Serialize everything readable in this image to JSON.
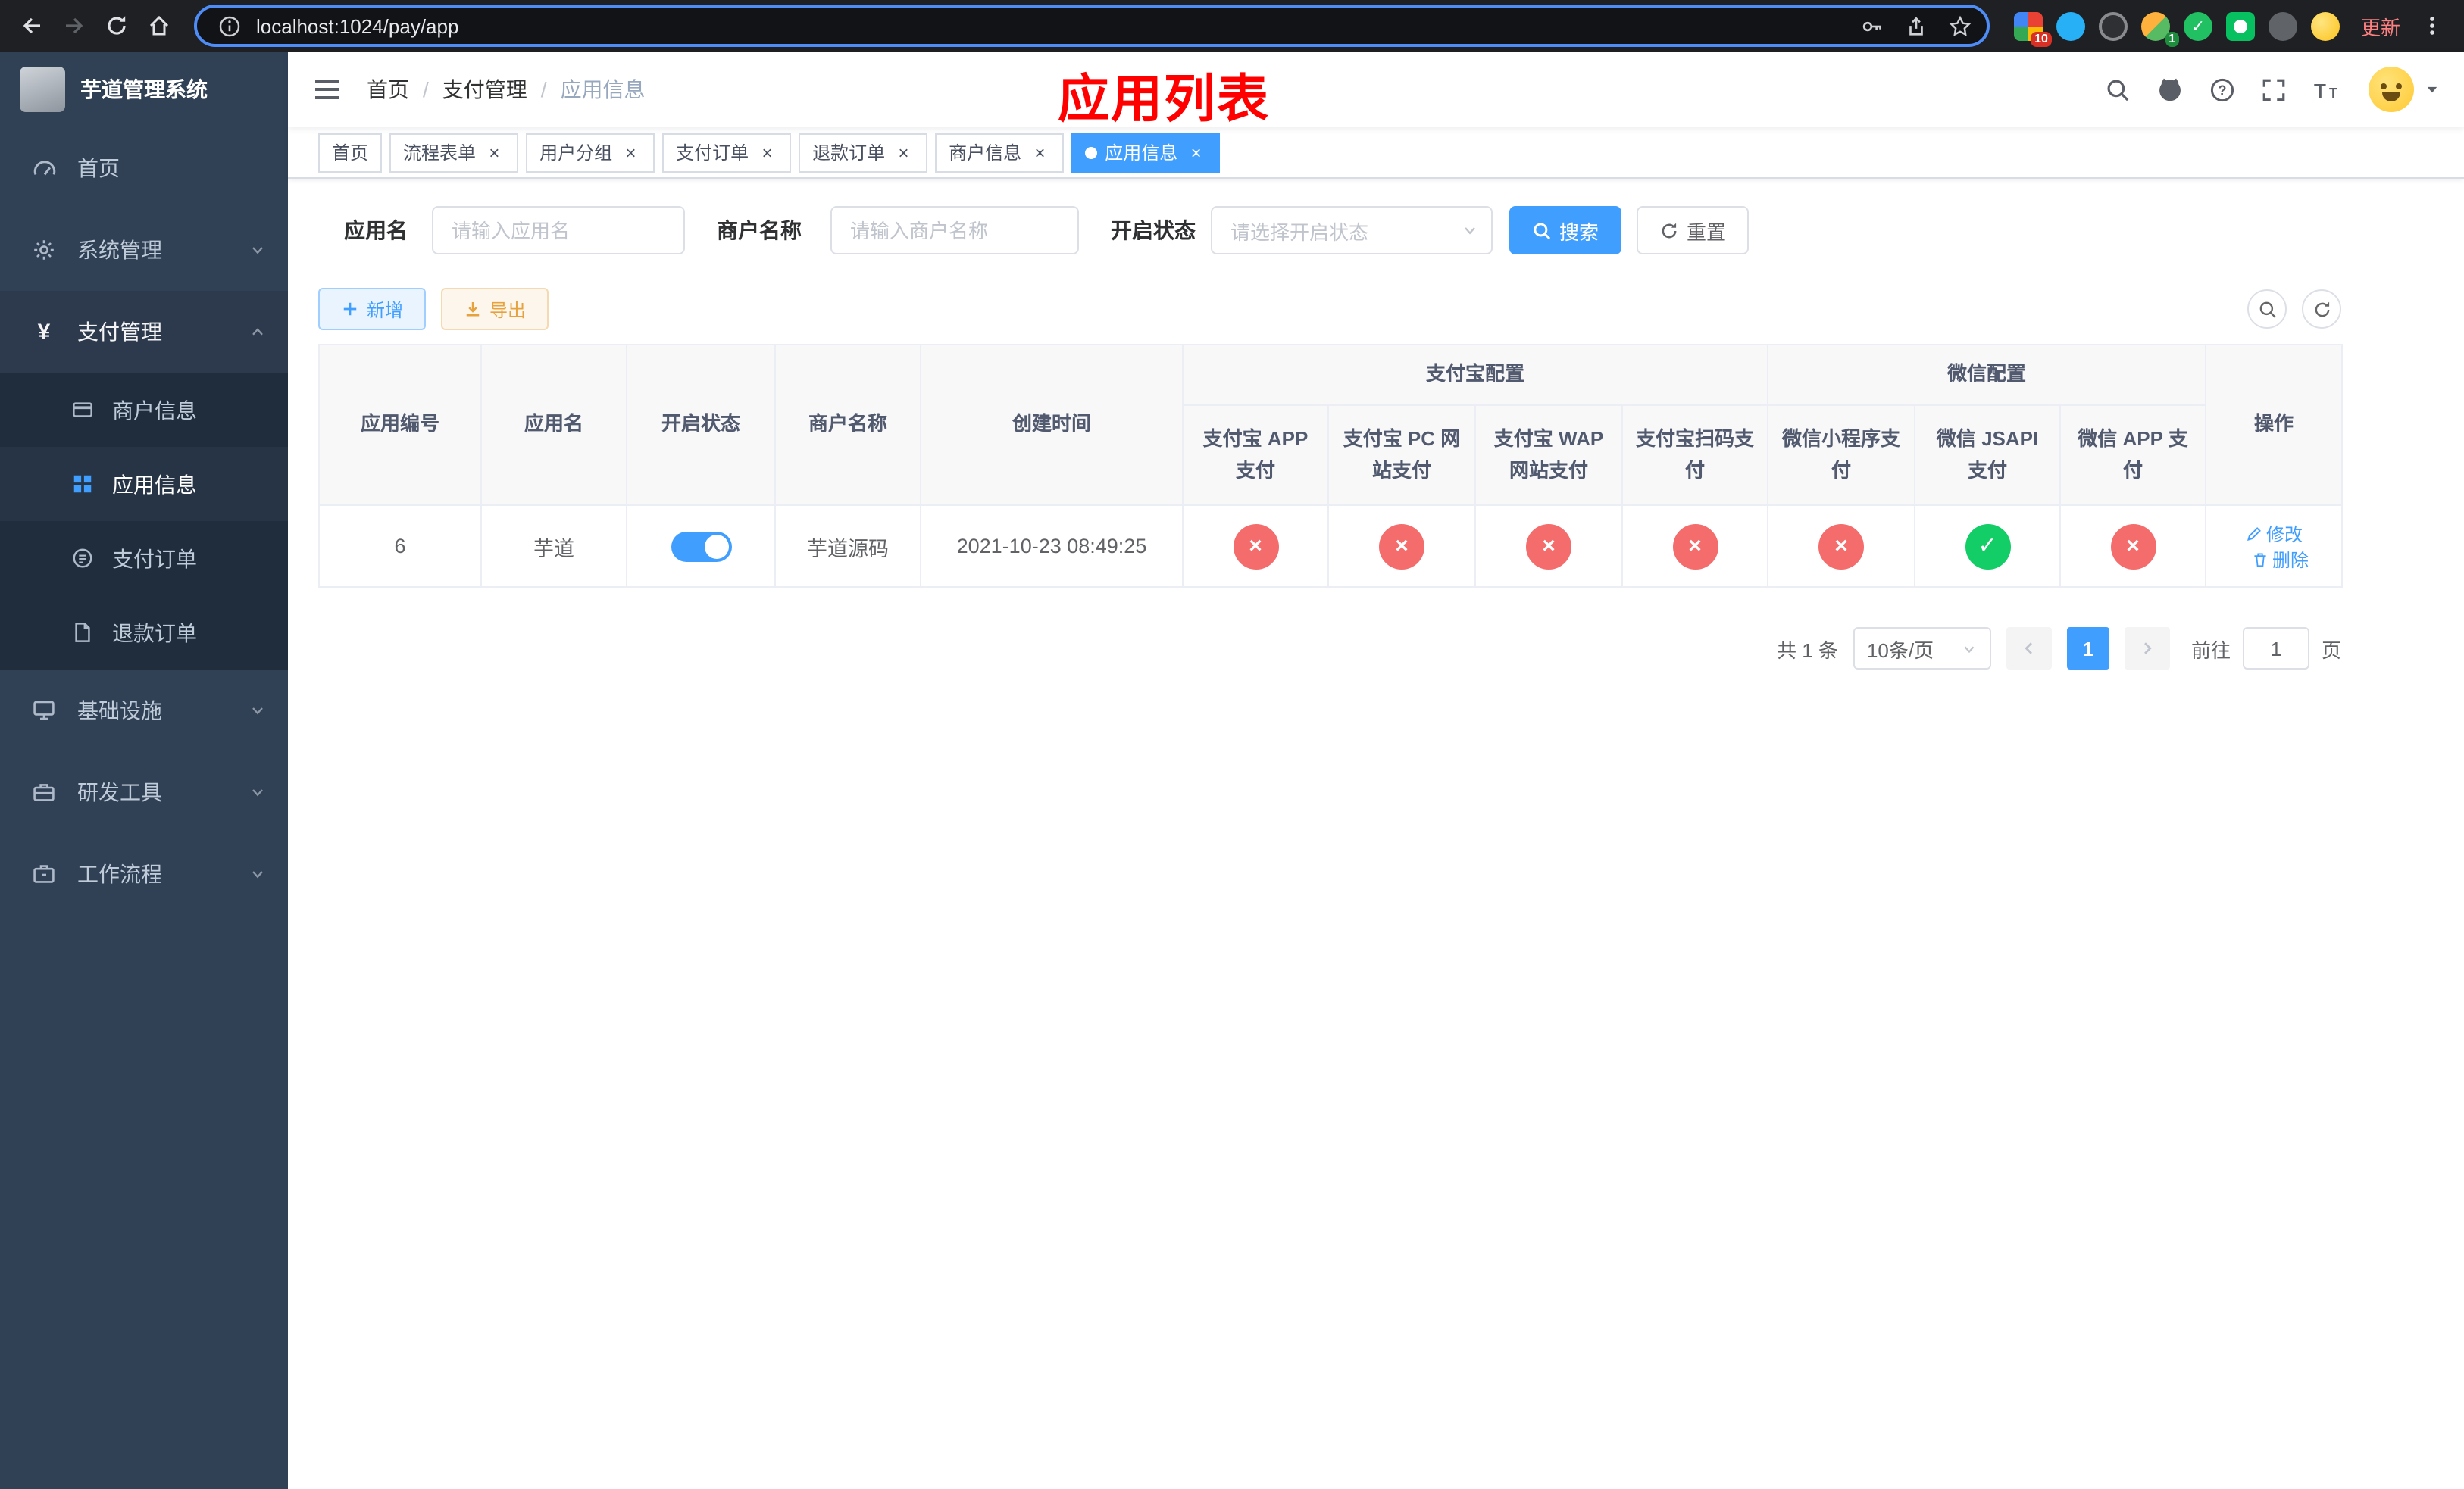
{
  "browser": {
    "url": "localhost:1024/pay/app",
    "update_label": "更新",
    "badges": {
      "red": "10",
      "green": "1"
    }
  },
  "sidebar": {
    "title": "芋道管理系统",
    "items": [
      {
        "label": "首页"
      },
      {
        "label": "系统管理"
      },
      {
        "label": "支付管理"
      },
      {
        "label": "商户信息"
      },
      {
        "label": "应用信息"
      },
      {
        "label": "支付订单"
      },
      {
        "label": "退款订单"
      },
      {
        "label": "基础设施"
      },
      {
        "label": "研发工具"
      },
      {
        "label": "工作流程"
      }
    ]
  },
  "header": {
    "breadcrumb": [
      "首页",
      "支付管理",
      "应用信息"
    ],
    "annotation": "应用列表"
  },
  "tabs": [
    {
      "label": "首页"
    },
    {
      "label": "流程表单"
    },
    {
      "label": "用户分组"
    },
    {
      "label": "支付订单"
    },
    {
      "label": "退款订单"
    },
    {
      "label": "商户信息"
    },
    {
      "label": "应用信息"
    }
  ],
  "filters": {
    "app_name_label": "应用名",
    "app_name_placeholder": "请输入应用名",
    "merchant_label": "商户名称",
    "merchant_placeholder": "请输入商户名称",
    "status_label": "开启状态",
    "status_placeholder": "请选择开启状态",
    "search_label": "搜索",
    "reset_label": "重置"
  },
  "toolbar": {
    "add_label": "新增",
    "export_label": "导出"
  },
  "table": {
    "group_alipay": "支付宝配置",
    "group_wechat": "微信配置",
    "col_id": "应用编号",
    "col_name": "应用名",
    "col_status": "开启状态",
    "col_merchant": "商户名称",
    "col_created": "创建时间",
    "col_alipay_app": "支付宝 APP 支付",
    "col_alipay_pc": "支付宝 PC 网站支付",
    "col_alipay_wap": "支付宝 WAP 网站支付",
    "col_alipay_qr": "支付宝扫码支付",
    "col_wx_mini": "微信小程序支付",
    "col_wx_jsapi": "微信 JSAPI 支付",
    "col_wx_app": "微信 APP 支付",
    "col_actions": "操作",
    "rows": [
      {
        "id": "6",
        "name": "芋道",
        "enabled": true,
        "merchant": "芋道源码",
        "created": "2021-10-23 08:49:25",
        "alipay_app": "no",
        "alipay_pc": "no",
        "alipay_wap": "no",
        "alipay_qr": "no",
        "wx_mini": "no",
        "wx_jsapi": "yes",
        "wx_app": "no",
        "edit_label": "修改",
        "delete_label": "删除"
      }
    ]
  },
  "pagination": {
    "total": "共 1 条",
    "page_size": "10条/页",
    "page": "1",
    "goto_label": "前往",
    "goto_value": "1",
    "unit": "页"
  },
  "icons": {
    "check": "✓",
    "cross": "×"
  },
  "colors": {
    "primary": "#409eff",
    "success": "#13ce66",
    "danger": "#f56c6c",
    "warning": "#e6a23c",
    "sidebar_bg": "#304156",
    "submenu_bg": "#1f2d3d",
    "annotation": "#ff0000"
  }
}
